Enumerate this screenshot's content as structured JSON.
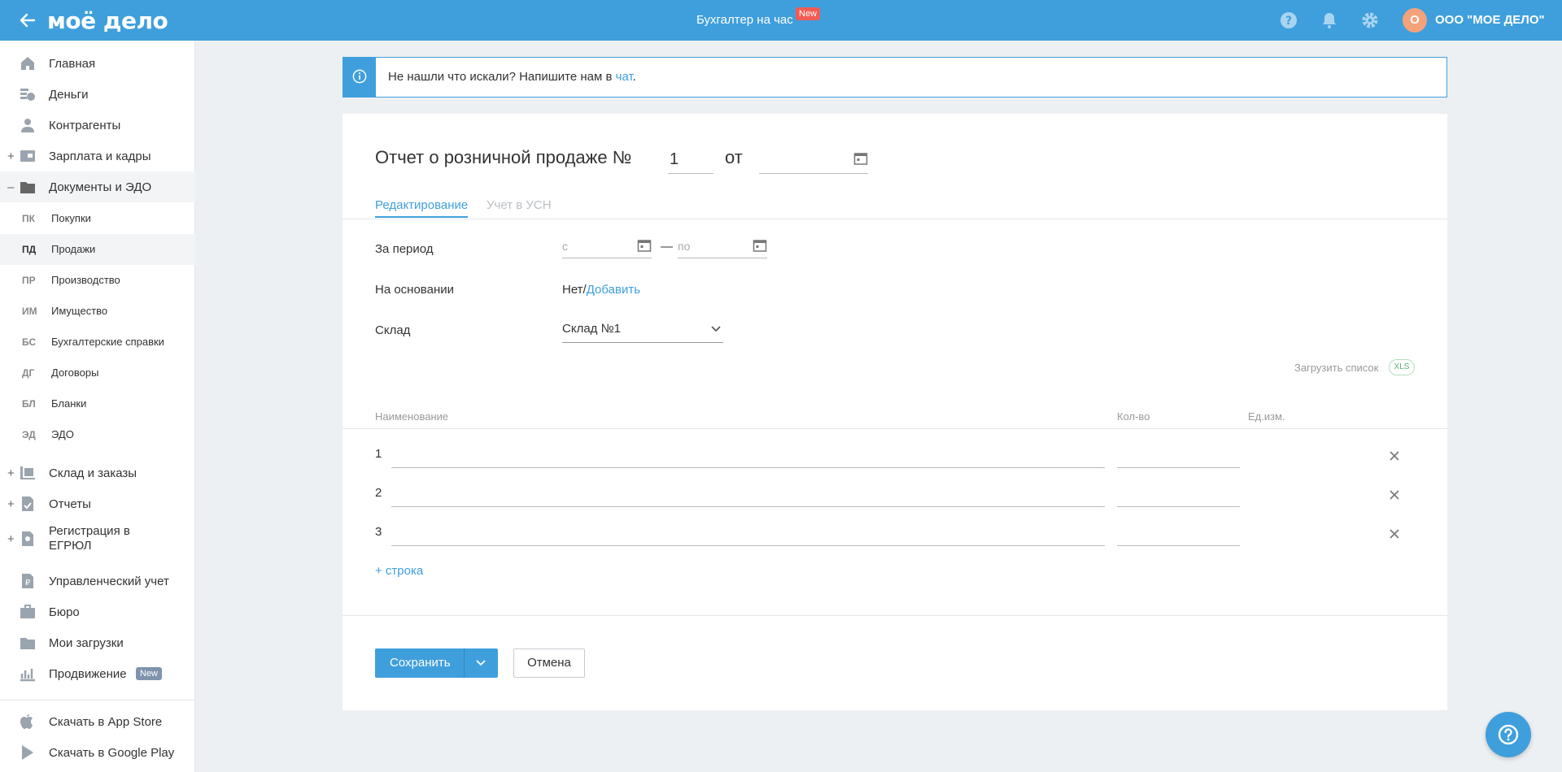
{
  "header": {
    "logo": "моё дело",
    "center_link": "Бухгалтер на час",
    "center_badge": "New",
    "org_initial": "О",
    "org_name": "ООО \"МОЕ ДЕЛО\"",
    "icons": [
      "back-arrow-icon",
      "help-circle-icon",
      "bell-icon",
      "gear-icon"
    ]
  },
  "sidebar": {
    "items": [
      {
        "label": "Главная",
        "icon": "home-icon"
      },
      {
        "label": "Деньги",
        "icon": "money-icon"
      },
      {
        "label": "Контрагенты",
        "icon": "contractor-icon"
      },
      {
        "label": "Зарплата и кадры",
        "icon": "salary-icon",
        "expander": "+"
      },
      {
        "label": "Документы и ЭДО",
        "icon": "folder-icon",
        "expander": "–"
      }
    ],
    "subitems": [
      {
        "abbr": "ПК",
        "label": "Покупки"
      },
      {
        "abbr": "ПД",
        "label": "Продажи"
      },
      {
        "abbr": "ПР",
        "label": "Производство"
      },
      {
        "abbr": "ИМ",
        "label": "Имущество"
      },
      {
        "abbr": "БС",
        "label": "Бухгалтерские справки"
      },
      {
        "abbr": "ДГ",
        "label": "Договоры"
      },
      {
        "abbr": "БЛ",
        "label": "Бланки"
      },
      {
        "abbr": "ЭД",
        "label": "ЭДО"
      }
    ],
    "items2": [
      {
        "label": "Склад и заказы",
        "expander": "+"
      },
      {
        "label": "Отчеты",
        "expander": "+"
      },
      {
        "label": "Регистрация в ЕГРЮЛ",
        "expander": "+"
      },
      {
        "label": "Управленческий учет"
      },
      {
        "label": "Бюро"
      },
      {
        "label": "Мои загрузки"
      },
      {
        "label": "Продвижение",
        "badge": "New"
      }
    ],
    "stores": [
      {
        "label": "Скачать в App Store",
        "icon": "apple-icon"
      },
      {
        "label": "Скачать в Google Play",
        "icon": "google-play-icon"
      }
    ]
  },
  "banner": {
    "text": "Не нашли что искали? Напишите нам в ",
    "link": "чат",
    "suffix": ".",
    "icon": "info-icon"
  },
  "form": {
    "title": "Отчет о розничной продаже №",
    "number": "1",
    "from_label": "от",
    "tabs": [
      {
        "label": "Редактирование",
        "active": true
      },
      {
        "label": "Учет в УСН",
        "active": false
      }
    ],
    "period_label": "За период",
    "period_from_placeholder": "с",
    "period_to_placeholder": "по",
    "period_dash": "—",
    "basis_label": "На основании",
    "basis_value": "Нет/",
    "basis_link": "Добавить",
    "warehouse_label": "Склад",
    "warehouse_value": "Склад №1",
    "upload_label": "Загрузить список",
    "upload_badge": "XLS",
    "columns": [
      "Наименование",
      "Кол-во",
      "Ед.изм."
    ],
    "rows": [
      {
        "num": "1",
        "name": "",
        "qty": ""
      },
      {
        "num": "2",
        "name": "",
        "qty": ""
      },
      {
        "num": "3",
        "name": "",
        "qty": ""
      }
    ],
    "add_row": "+ строка",
    "save": "Сохранить",
    "cancel": "Отмена"
  },
  "colors": {
    "accent": "#3f9fdc",
    "badge_red": "#f25c54",
    "badge_grey": "#7f93ad",
    "avatar": "#f4a27a"
  }
}
